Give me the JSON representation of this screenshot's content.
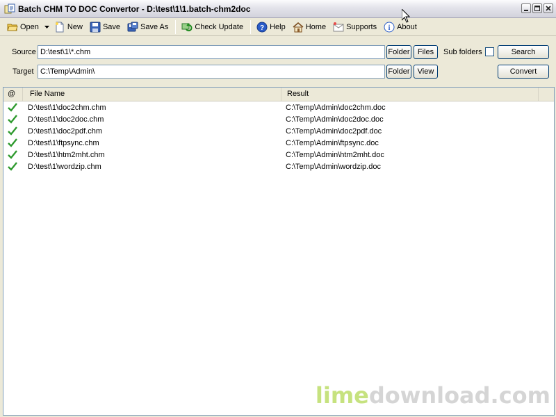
{
  "window": {
    "title": "Batch CHM TO DOC Convertor - D:\\test\\1\\1.batch-chm2doc",
    "controls": [
      "minimize",
      "maximize",
      "close"
    ]
  },
  "toolbar": {
    "open": "Open",
    "new": "New",
    "save": "Save",
    "save_as": "Save As",
    "check_update": "Check Update",
    "help": "Help",
    "home": "Home",
    "supports": "Supports",
    "about": "About"
  },
  "form": {
    "source_label": "Source",
    "source_value": "D:\\test\\1\\*.chm",
    "target_label": "Target",
    "target_value": "C:\\Temp\\Admin\\",
    "folder_btn": "Folder",
    "files_btn": "Files",
    "view_btn": "View",
    "subfolders_label": "Sub folders",
    "search_btn": "Search",
    "convert_btn": "Convert"
  },
  "list": {
    "columns": [
      "@",
      "File Name",
      "Result"
    ],
    "rows": [
      {
        "file": "D:\\test\\1\\doc2chm.chm",
        "result": "C:\\Temp\\Admin\\doc2chm.doc"
      },
      {
        "file": "D:\\test\\1\\doc2doc.chm",
        "result": "C:\\Temp\\Admin\\doc2doc.doc"
      },
      {
        "file": "D:\\test\\1\\doc2pdf.chm",
        "result": "C:\\Temp\\Admin\\doc2pdf.doc"
      },
      {
        "file": "D:\\test\\1\\ftpsync.chm",
        "result": "C:\\Temp\\Admin\\ftpsync.doc"
      },
      {
        "file": "D:\\test\\1\\htm2mht.chm",
        "result": "C:\\Temp\\Admin\\htm2mht.doc"
      },
      {
        "file": "D:\\test\\1\\wordzip.chm",
        "result": "C:\\Temp\\Admin\\wordzip.doc"
      }
    ]
  },
  "watermark": {
    "part1": "lime",
    "part2": "download.com"
  },
  "colors": {
    "accent_check": "#2e9a2e",
    "watermark_lime": "#c6e27f"
  }
}
